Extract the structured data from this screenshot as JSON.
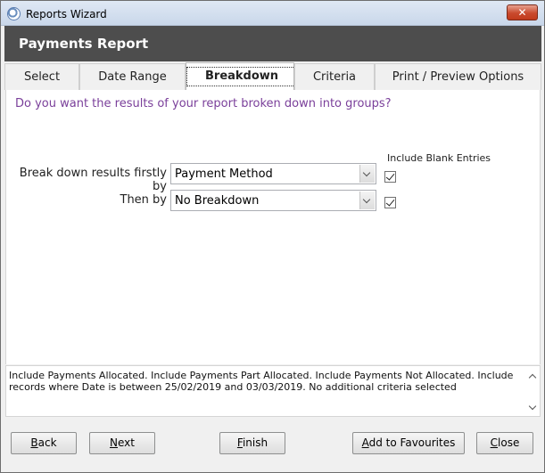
{
  "window": {
    "title": "Reports Wizard",
    "close_label": "✕"
  },
  "header": {
    "title": "Payments Report"
  },
  "tabs": [
    {
      "label": "Select",
      "active": false
    },
    {
      "label": "Date Range",
      "active": false
    },
    {
      "label": "Breakdown",
      "active": true
    },
    {
      "label": "Criteria",
      "active": false
    },
    {
      "label": "Print / Preview Options",
      "active": false
    }
  ],
  "breakdown": {
    "question": "Do you want the results of your report broken down into groups?",
    "include_blank_header": "Include Blank Entries",
    "rows": [
      {
        "label": "Break down results firstly by",
        "value": "Payment Method",
        "include_blank": true
      },
      {
        "label": "Then by",
        "value": "No Breakdown",
        "include_blank": true
      }
    ]
  },
  "summary": {
    "text": "Include Payments Allocated. Include Payments Part Allocated. Include Payments Not Allocated. Include records where Date is between 25/02/2019 and 03/03/2019. No additional criteria selected"
  },
  "buttons": {
    "back": {
      "mnemonic": "B",
      "rest": "ack"
    },
    "next": {
      "mnemonic": "N",
      "rest": "ext"
    },
    "finish": {
      "mnemonic": "F",
      "rest": "inish"
    },
    "favourites": {
      "mnemonic": "A",
      "rest": "dd to Favourites"
    },
    "close": {
      "mnemonic": "C",
      "rest": "lose"
    }
  }
}
